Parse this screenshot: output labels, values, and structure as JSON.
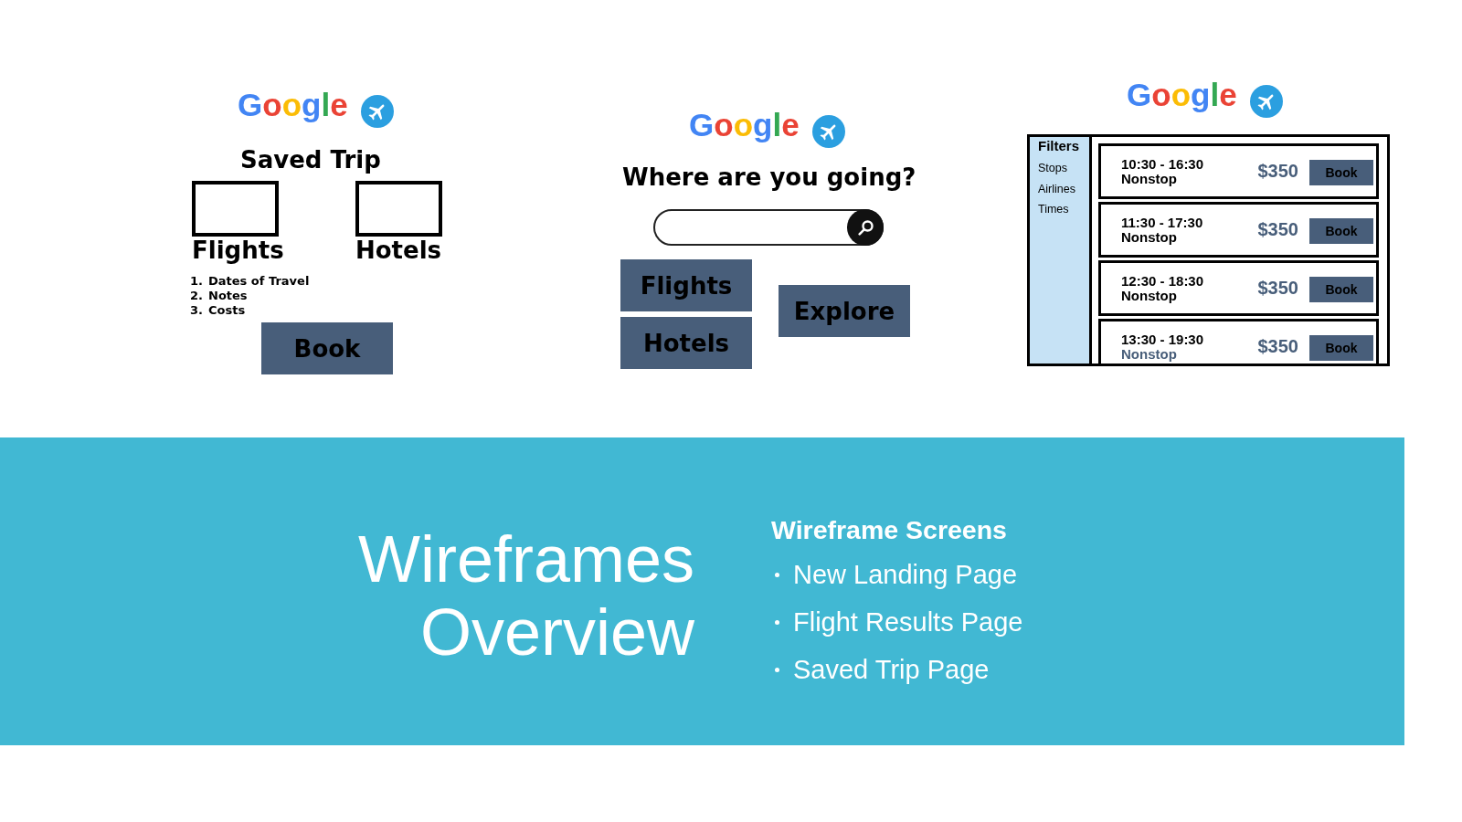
{
  "screens": [
    {
      "kind": "saved_trip",
      "logo": "Google",
      "title": "Saved Trip",
      "sections": [
        {
          "label": "Flights"
        },
        {
          "label": "Hotels"
        }
      ],
      "details": [
        {
          "number": "1.",
          "text": "Dates of Travel"
        },
        {
          "number": "2.",
          "text": "Notes"
        },
        {
          "number": "3.",
          "text": "Costs"
        }
      ],
      "button": "Book"
    },
    {
      "kind": "landing",
      "logo": "Google",
      "heading": "Where are you going?",
      "buttons": [
        {
          "label": "Flights"
        },
        {
          "label": "Hotels"
        },
        {
          "label": "Explore"
        }
      ]
    },
    {
      "kind": "results",
      "logo": "Google",
      "filters": {
        "title": "Filters",
        "options": [
          "Stops",
          "Airlines",
          "Times"
        ]
      },
      "flights": [
        {
          "times": "10:30 - 16:30",
          "stops": "Nonstop",
          "color": "#000000",
          "price": "$350",
          "button": "Book"
        },
        {
          "times": "11:30 - 17:30",
          "stops": "Nonstop",
          "color": "#000000",
          "price": "$350",
          "button": "Book"
        },
        {
          "times": "12:30 - 18:30",
          "stops": "Nonstop",
          "color": "#000000",
          "price": "$350",
          "button": "Book"
        },
        {
          "times": "13:30 - 19:30",
          "stops": "Nonstop",
          "color": "#485e7a",
          "price": "$350",
          "button": "Book"
        }
      ]
    }
  ],
  "banner": {
    "title": "Wireframes Overview",
    "list_title": "Wireframe Screens",
    "items": [
      "New Landing Page",
      "Flight Results Page",
      "Saved Trip Page"
    ]
  }
}
